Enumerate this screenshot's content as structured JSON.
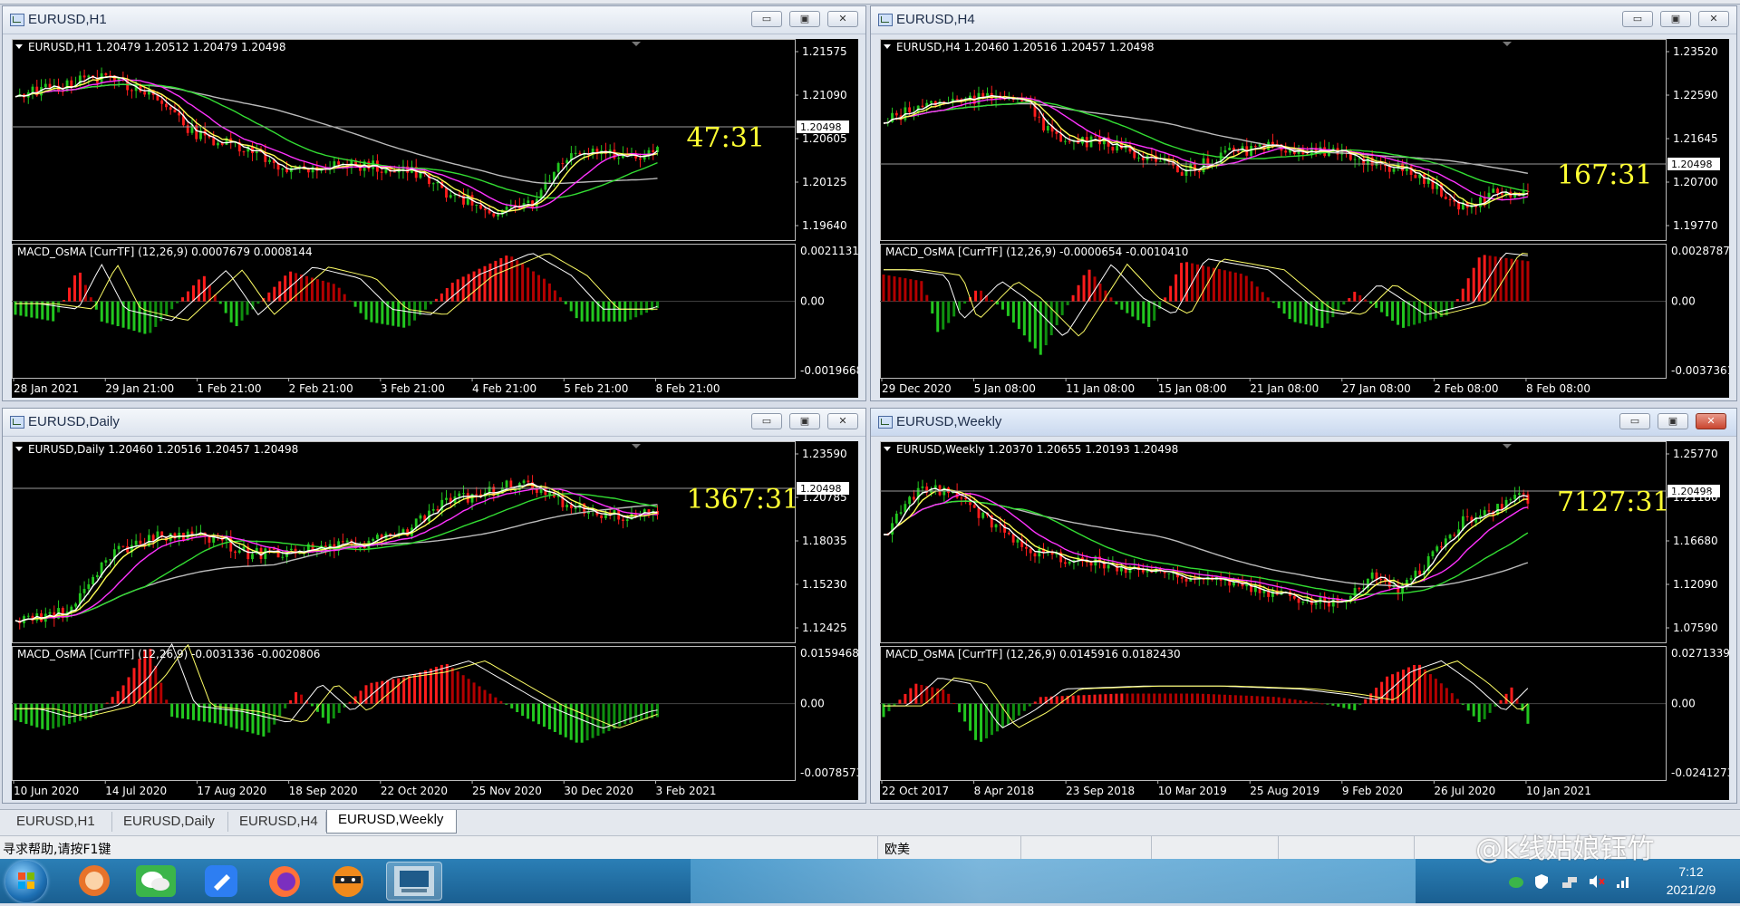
{
  "windows": [
    {
      "id": "h1",
      "title": "EURUSD,H1",
      "header": "EURUSD,H1  1.20479 1.20512 1.20479 1.20498",
      "timer": "47:31",
      "price_ticks": [
        "1.21575",
        "1.21090",
        "1.20605",
        "1.20125",
        "1.19640"
      ],
      "price_line": "1.20498",
      "macd_title": "MACD_OsMA [CurrTF] (12,26,9) 0.0007679 0.0008144",
      "macd_ticks": [
        "0.0021131",
        "0.00",
        "-0.0019668"
      ],
      "dates": [
        "28 Jan 2021",
        "29 Jan 21:00",
        "1 Feb 21:00",
        "2 Feb 21:00",
        "3 Feb 21:00",
        "4 Feb 21:00",
        "5 Feb 21:00",
        "8 Feb 21:00"
      ],
      "active": false
    },
    {
      "id": "h4",
      "title": "EURUSD,H4",
      "header": "EURUSD,H4  1.20460 1.20516 1.20457 1.20498",
      "timer": "167:31",
      "price_ticks": [
        "1.23520",
        "1.22590",
        "1.21645",
        "1.20700",
        "1.19770"
      ],
      "price_line": "1.20498",
      "macd_title": "MACD_OsMA [CurrTF] (12,26,9) -0.0000654 -0.0010410",
      "macd_ticks": [
        "0.0028787",
        "0.00",
        "-0.0037361"
      ],
      "dates": [
        "29 Dec 2020",
        "5 Jan 08:00",
        "11 Jan 08:00",
        "15 Jan 08:00",
        "21 Jan 08:00",
        "27 Jan 08:00",
        "2 Feb 08:00",
        "8 Feb 08:00"
      ],
      "active": false
    },
    {
      "id": "daily",
      "title": "EURUSD,Daily",
      "header": "EURUSD,Daily  1.20460 1.20516 1.20457 1.20498",
      "timer": "1367:31",
      "price_ticks": [
        "1.23590",
        "1.20785",
        "1.18035",
        "1.15230",
        "1.12425"
      ],
      "price_line": "1.20498",
      "macd_title": "MACD_OsMA [CurrTF] (12,26,9) -0.0031336 -0.0020806",
      "macd_ticks": [
        "0.0159468",
        "0.00",
        "-0.0078573"
      ],
      "dates": [
        "10 Jun 2020",
        "14 Jul 2020",
        "17 Aug 2020",
        "18 Sep 2020",
        "22 Oct 2020",
        "25 Nov 2020",
        "30 Dec 2020",
        "3 Feb 2021"
      ],
      "active": false
    },
    {
      "id": "weekly",
      "title": "EURUSD,Weekly",
      "header": "EURUSD,Weekly  1.20370 1.20655 1.20193 1.20498",
      "timer": "7127:31",
      "price_ticks": [
        "1.25770",
        "1.21180",
        "1.16680",
        "1.12090",
        "1.07590"
      ],
      "price_line": "1.20498",
      "macd_title": "MACD_OsMA [CurrTF] (12,26,9) 0.0145916 0.0182430",
      "macd_ticks": [
        "0.0271339",
        "0.00",
        "-0.0241273"
      ],
      "dates": [
        "22 Oct 2017",
        "8 Apr 2018",
        "23 Sep 2018",
        "10 Mar 2019",
        "25 Aug 2019",
        "9 Feb 2020",
        "26 Jul 2020",
        "10 Jan 2021"
      ],
      "active": true
    }
  ],
  "window_buttons": {
    "minimize": "▭",
    "maximize": "▣",
    "close": "✕"
  },
  "tabs": [
    "EURUSD,H1",
    "EURUSD,Daily",
    "EURUSD,H4",
    "EURUSD,Weekly"
  ],
  "active_tab": "EURUSD,Weekly",
  "status": {
    "help": "寻求帮助,请按F1键",
    "profile": "欧美"
  },
  "tray": {
    "time": "7:12",
    "date": "2021/2/9"
  },
  "watermark": "@k线姑娘钰竹",
  "colors": {
    "bull": "#22c71f",
    "bear": "#ff1c1c",
    "ma_white": "#ffffff",
    "ma_yellow": "#ffff55",
    "ma_magenta": "#ff33ff",
    "ma_green": "#33dd33",
    "ma_gray": "#bbbbbb",
    "timer": "#ffff33"
  }
}
